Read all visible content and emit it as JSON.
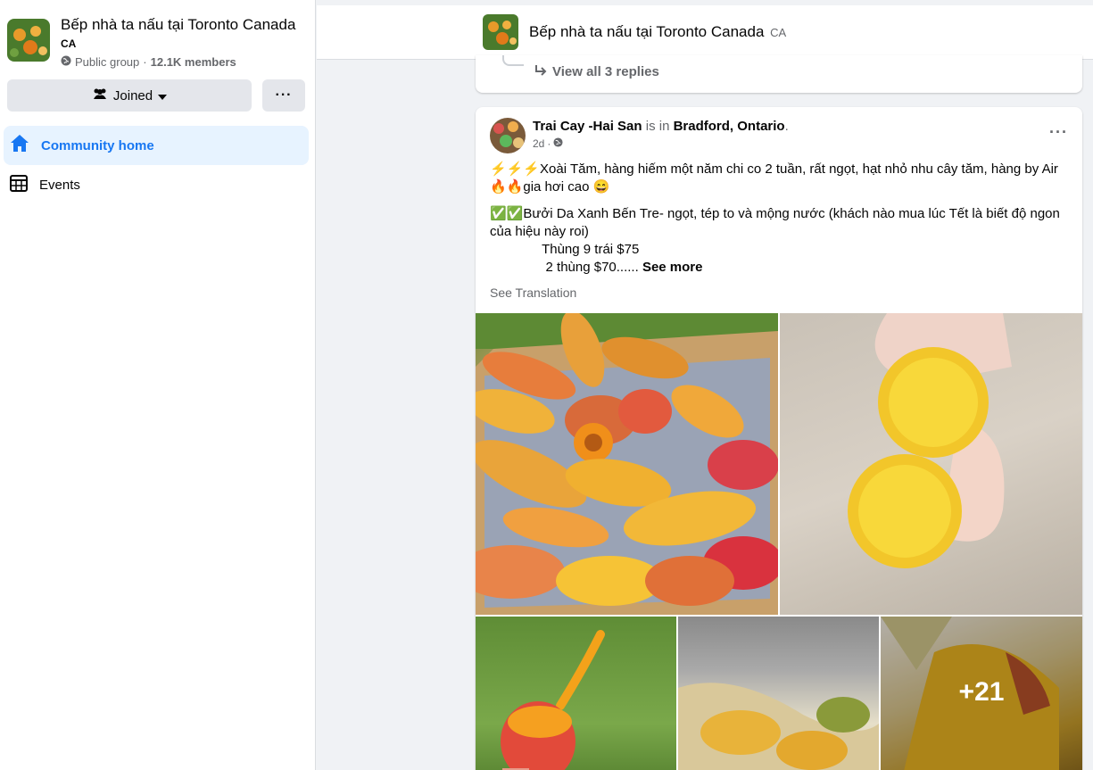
{
  "sidebar": {
    "group_name": "Bếp nhà ta nấu tại Toronto Canada",
    "group_tag": "CA",
    "privacy": "Public group",
    "separator": "·",
    "members": "12.1K members",
    "joined_label": "Joined",
    "more_label": "···",
    "nav": [
      {
        "label": "Community home",
        "icon": "home-icon",
        "active": true
      },
      {
        "label": "Events",
        "icon": "calendar-icon",
        "active": false
      }
    ]
  },
  "header": {
    "title": "Bếp nhà ta nấu tại Toronto Canada",
    "tag": "CA"
  },
  "prev_card": {
    "view_replies": "View all 3 replies"
  },
  "post": {
    "author": "Trai Cay -Hai San",
    "is_in": "is in",
    "location": "Bradford, Ontario",
    "period": ".",
    "time": "2d",
    "time_sep": "·",
    "more": "···",
    "para1_emoji": "⚡⚡⚡",
    "para1_text": "Xoài Tăm, hàng hiếm một năm chi co 2 tuần, rất ngọt, hạt nhỏ nhu cây tăm, hàng by Air ",
    "para1_emoji2": "🔥🔥",
    "para1_text2": "gia hơi cao 😄",
    "para2_emoji": "✅✅",
    "para2_text": "Bưởi Da Xanh Bến Tre- ngọt, tép to và mộng nước (khách nào mua lúc Tết là biết độ ngon của hiệu này roi)",
    "line3": "              Thùng 9 trái $75",
    "line4": "               2 thùng $70......",
    "see_more": "See more",
    "see_translation": "See Translation",
    "more_photos": "+21"
  },
  "colors": {
    "accent": "#1877f2",
    "nav_active_bg": "#e7f3ff",
    "button_bg": "#e4e6eb",
    "secondary_text": "#65676b",
    "page_bg": "#f0f2f5"
  }
}
